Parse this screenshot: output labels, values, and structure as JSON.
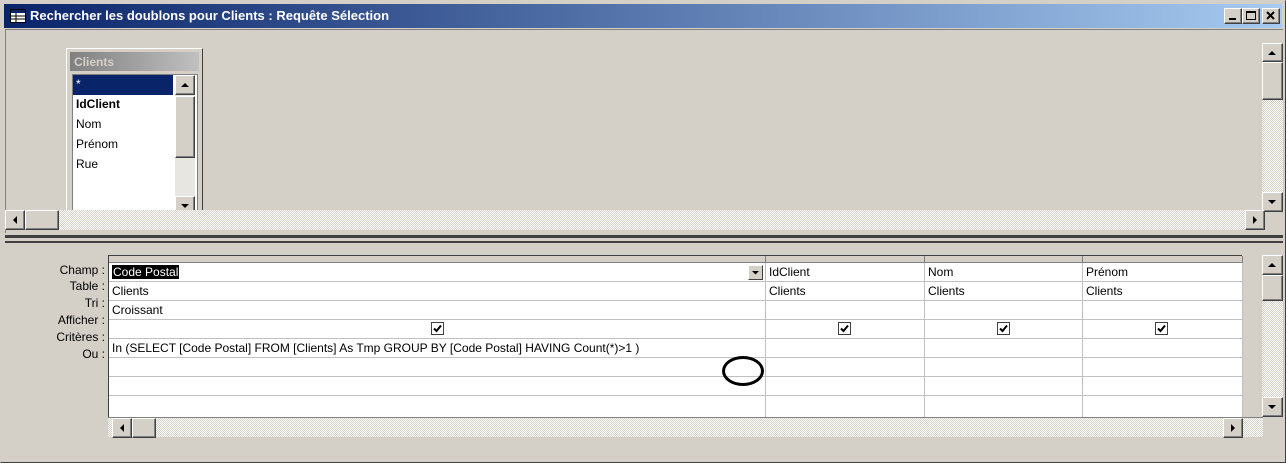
{
  "window": {
    "title": "Rechercher les doublons pour Clients : Requête Sélection",
    "title_icon": "query-icon",
    "controls": [
      "minimize-icon",
      "maximize-icon",
      "close-icon"
    ]
  },
  "field_list": {
    "table_name": "Clients",
    "fields": [
      {
        "label": "*",
        "selected": true,
        "primary_key": false
      },
      {
        "label": "IdClient",
        "selected": false,
        "primary_key": true
      },
      {
        "label": "Nom",
        "selected": false,
        "primary_key": false
      },
      {
        "label": "Prénom",
        "selected": false,
        "primary_key": false
      },
      {
        "label": "Rue",
        "selected": false,
        "primary_key": false
      }
    ]
  },
  "grid": {
    "row_labels": [
      "Champ :",
      "Table :",
      "Tri :",
      "Afficher :",
      "Critères :",
      "Ou :"
    ],
    "columns": [
      {
        "champ": "Code Postal",
        "table": "Clients",
        "tri": "Croissant",
        "afficher": true,
        "criteres": "In (SELECT [Code Postal] FROM [Clients] As Tmp GROUP BY [Code Postal] HAVING Count(*)>1 )",
        "ou": ""
      },
      {
        "champ": "IdClient",
        "table": "Clients",
        "tri": "",
        "afficher": true,
        "criteres": "",
        "ou": ""
      },
      {
        "champ": "Nom",
        "table": "Clients",
        "tri": "",
        "afficher": true,
        "criteres": "",
        "ou": ""
      },
      {
        "champ": "Prénom",
        "table": "Clients",
        "tri": "",
        "afficher": true,
        "criteres": "",
        "ou": ""
      }
    ],
    "highlight_annotation": "circle around \">1\" in criteria"
  },
  "colors": {
    "titlebar_start": "#0a246a",
    "titlebar_end": "#a6caf0",
    "face": "#d4d0c8",
    "selection": "#0a246a"
  }
}
